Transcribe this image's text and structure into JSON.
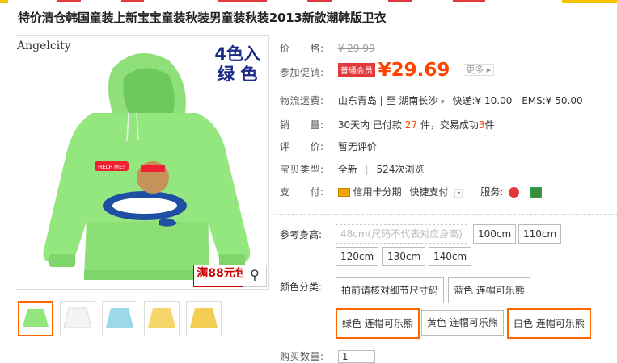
{
  "title": "特价清仓韩国童装上新宝宝童装秋装男童装秋装2013新款潮韩版卫衣",
  "image": {
    "brand": "Angelcity",
    "color_tag_line1": "4色入",
    "color_tag_line2": "绿 色",
    "promo": "满88元包"
  },
  "fields": {
    "price_label": "价　　格:",
    "price_value": "¥ 29.99",
    "promo_label": "参加促销:",
    "member_tag": "普通会员",
    "promo_price": "¥29.69",
    "more": "更多",
    "shipping_label": "物流运费:",
    "shipping_value": "山东青岛 | 至  湖南长沙",
    "express": "快递:¥ 10.00",
    "ems": "EMS:¥ 50.00",
    "sales_label": "销　　量:",
    "sales_prefix": "30天内 已付款",
    "sales_count": "27",
    "sales_mid": "件，交易成功",
    "sales_done": "3",
    "sales_suffix": "件",
    "rating_label": "评　　价:",
    "rating_value": "暂无评价",
    "type_label": "宝贝类型:",
    "type_value": "全新",
    "views": "524次浏览",
    "pay_label": "支　　付:",
    "pay_value": "信用卡分期",
    "quickpay": "快捷支付",
    "service": "服务:"
  },
  "size": {
    "label": "参考身高:",
    "options": [
      "48cm(尺码不代表对应身高)",
      "100cm",
      "110cm",
      "120cm",
      "130cm",
      "140cm"
    ]
  },
  "color": {
    "label": "颜色分类:",
    "options": [
      "拍前请核对细节尺寸码",
      "蓝色 连帽可乐熊",
      "绿色 连帽可乐熊",
      "黄色 连帽可乐熊",
      "白色 连帽可乐熊"
    ]
  },
  "qty": {
    "label": "购买数量:",
    "value": "1"
  }
}
